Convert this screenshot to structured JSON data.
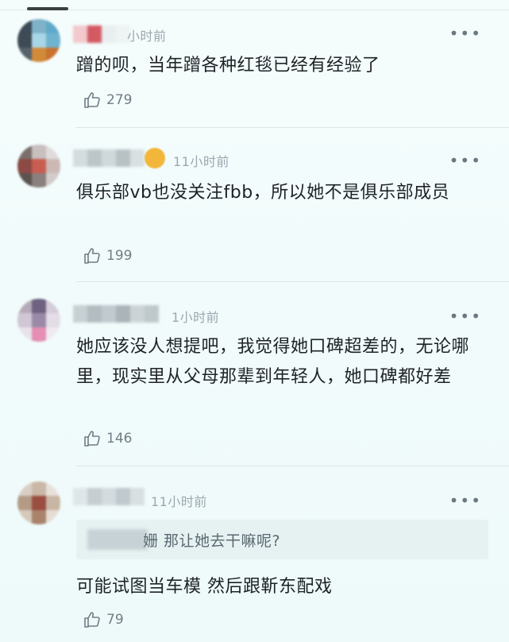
{
  "comments": [
    {
      "time": "小时前",
      "text": "蹭的呗，当年蹭各种红毯已经有经验了",
      "likes": "279",
      "more_icon": "more-dots-icon",
      "like_icon": "thumbs-up-icon"
    },
    {
      "time": "11小时前",
      "text": "俱乐部vb也没关注fbb，所以她不是俱乐部成员",
      "likes": "199",
      "more_icon": "more-dots-icon",
      "like_icon": "thumbs-up-icon"
    },
    {
      "time": "1小时前",
      "text": "她应该没人想提吧，我觉得她口碑超差的，无论哪里，现实里从父母那辈到年轻人，她口碑都好差",
      "likes": "146",
      "more_icon": "more-dots-icon",
      "like_icon": "thumbs-up-icon"
    },
    {
      "time": "11小时前",
      "quote": "姗 那让她去干嘛呢?",
      "text": "可能试图当车模 然后跟靳东配戏",
      "likes": "79",
      "more_icon": "more-dots-icon",
      "like_icon": "thumbs-up-icon"
    }
  ],
  "colors": {
    "background": "#f3fbfb",
    "text": "#1e2326",
    "muted": "#9aa8b0",
    "accent_emoji": "#f2b63a"
  }
}
